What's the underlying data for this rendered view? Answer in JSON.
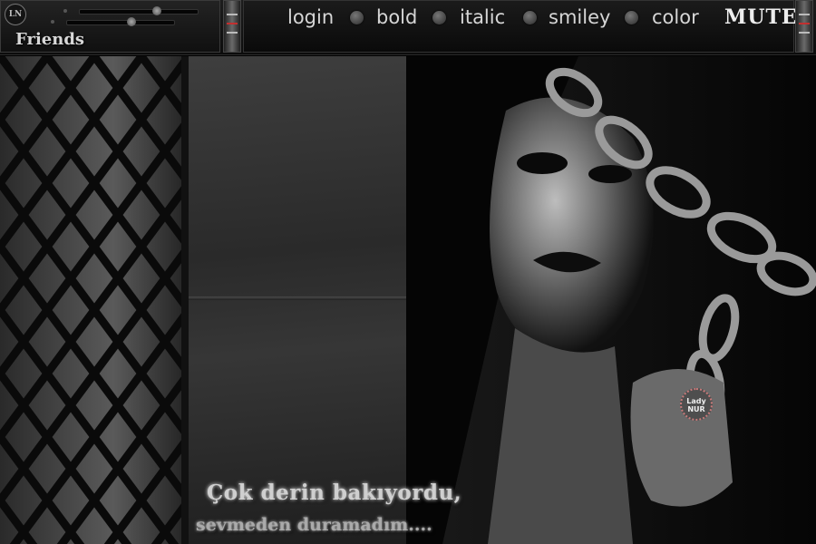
{
  "left_panel": {
    "logo_text": "LN",
    "friends_label": "Friends"
  },
  "menu": {
    "items": [
      {
        "label": "login"
      },
      {
        "label": "bold"
      },
      {
        "label": "italic"
      },
      {
        "label": "smiley"
      },
      {
        "label": "color"
      }
    ],
    "mute_label": "MUTE"
  },
  "artwork": {
    "caption_line1": "Çok derin bakıyordu,",
    "caption_line2": "sevmeden duramadım....",
    "watermark_text": "Lady NUR"
  },
  "colors": {
    "accent_red": "#c23030",
    "watermark_border": "#c87a7a"
  }
}
